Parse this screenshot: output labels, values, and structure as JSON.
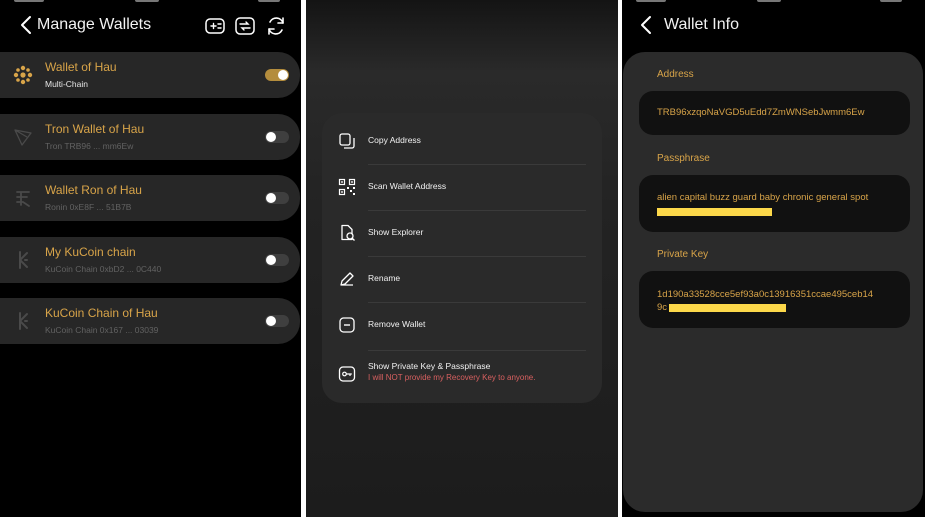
{
  "colors": {
    "accent": "#d8a449",
    "card": "#272727",
    "warning": "#d86060"
  },
  "manage": {
    "title": "Manage Wallets",
    "icons": [
      "add-wallet-icon",
      "import-wallet-icon",
      "sync-icon"
    ],
    "wallets": [
      {
        "name": "Wallet of Hau",
        "sub": "Multi-Chain",
        "icon": "multichain-icon",
        "enabled": true
      },
      {
        "name": "Tron Wallet of Hau",
        "sub": "Tron TRB96 ... mm6Ew",
        "icon": "tron-icon",
        "enabled": false
      },
      {
        "name": "Wallet Ron of Hau",
        "sub": "Ronin 0xE8F ... 51B7B",
        "icon": "ronin-icon",
        "enabled": false
      },
      {
        "name": "My KuCoin chain",
        "sub": "KuCoin Chain 0xbD2 ... 0C440",
        "icon": "kucoin-icon",
        "enabled": false
      },
      {
        "name": "KuCoin Chain of Hau",
        "sub": "KuCoin Chain 0x167 ... 03039",
        "icon": "kucoin-icon",
        "enabled": false
      }
    ]
  },
  "menu": {
    "items": [
      {
        "label": "Copy Address",
        "icon": "copy-icon"
      },
      {
        "label": "Scan Wallet Address",
        "icon": "qr-icon"
      },
      {
        "label": "Show Explorer",
        "icon": "explorer-icon"
      },
      {
        "label": "Rename",
        "icon": "pencil-icon"
      },
      {
        "label": "Remove Wallet",
        "icon": "remove-icon"
      },
      {
        "label": "Show Private Key & Passphrase",
        "icon": "key-icon",
        "warning": "I will NOT provide my Recovery Key to anyone."
      }
    ]
  },
  "info": {
    "title": "Wallet Info",
    "address_label": "Address",
    "address": "TRB96xzqoNaVGD5uEdd7ZmWNSebJwmm6Ew",
    "passphrase_label": "Passphrase",
    "passphrase": "alien capital buzz guard baby chronic general spot",
    "private_key_label": "Private Key",
    "private_key_line1": "1d190a33528cce5ef93a0c13916351ccae495ceb14",
    "private_key_line2": "9c"
  }
}
